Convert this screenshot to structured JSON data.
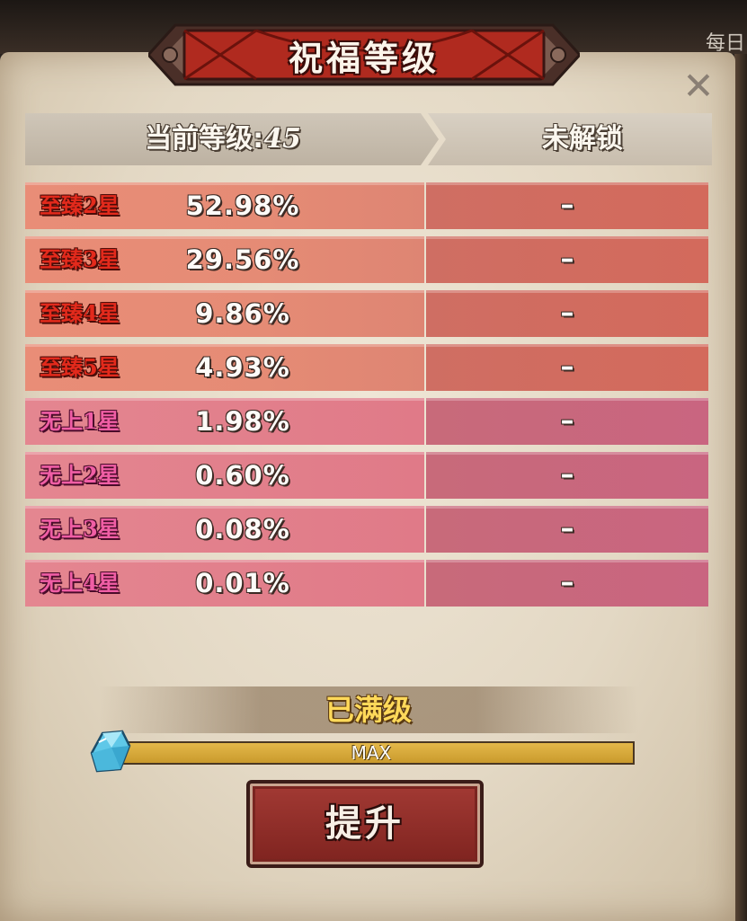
{
  "background": {
    "corner_text": "每日"
  },
  "dialog": {
    "title": "祝福等级",
    "close_icon": "close-icon"
  },
  "header": {
    "current_level_label": "当前等级:",
    "current_level_value": "45",
    "next_label": "未解锁"
  },
  "rows": [
    {
      "rank": "至臻2星",
      "tier": "red",
      "current": "52.98%",
      "next": "–"
    },
    {
      "rank": "至臻3星",
      "tier": "red",
      "current": "29.56%",
      "next": "–"
    },
    {
      "rank": "至臻4星",
      "tier": "red",
      "current": "9.86%",
      "next": "–"
    },
    {
      "rank": "至臻5星",
      "tier": "red",
      "current": "4.93%",
      "next": "–"
    },
    {
      "rank": "无上1星",
      "tier": "pink",
      "current": "1.98%",
      "next": "–"
    },
    {
      "rank": "无上2星",
      "tier": "pink",
      "current": "0.60%",
      "next": "–"
    },
    {
      "rank": "无上3星",
      "tier": "pink",
      "current": "0.08%",
      "next": "–"
    },
    {
      "rank": "无上4星",
      "tier": "pink",
      "current": "0.01%",
      "next": "–"
    }
  ],
  "status": {
    "label": "已满级",
    "progress_text": "MAX",
    "progress_fraction": 1.0,
    "icon": "crystal-icon"
  },
  "upgrade_button": {
    "label": "提升"
  },
  "colors": {
    "title_red": "#a3231b",
    "red_row": "#e58b75",
    "pink_row": "#e07a88",
    "status_yellow": "#ffd95a",
    "progress_gold": "#d6a93a"
  }
}
